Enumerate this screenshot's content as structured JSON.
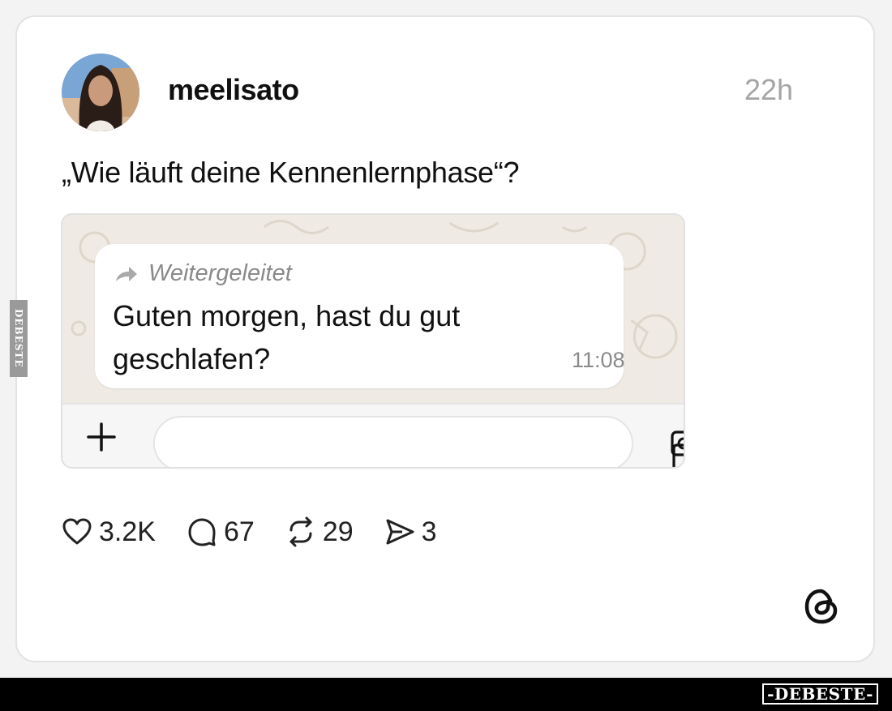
{
  "post": {
    "username": "meelisato",
    "time": "22h",
    "text": "„Wie läuft deine Kennenlernphase“?"
  },
  "chat_screenshot": {
    "forwarded_label": "Weitergeleitet",
    "message": "Guten morgen, hast du gut geschlafen?",
    "message_time": "11:08",
    "icons": [
      "forward-arrow-icon",
      "plus-icon",
      "sticker-icon",
      "camera-icon"
    ]
  },
  "actions": {
    "likes": "3.2K",
    "replies": "67",
    "reposts": "29",
    "shares": "3"
  },
  "icons": [
    "heart-icon",
    "comment-icon",
    "repost-icon",
    "share-icon",
    "threads-logo-icon"
  ],
  "watermark": {
    "side": "DEBESTE",
    "footer": "-DEBESTE-"
  },
  "colors": {
    "card_bg": "#ffffff",
    "muted_text": "#a5a5a5",
    "chat_bg": "#efebe4",
    "footer_bg": "#000000"
  }
}
